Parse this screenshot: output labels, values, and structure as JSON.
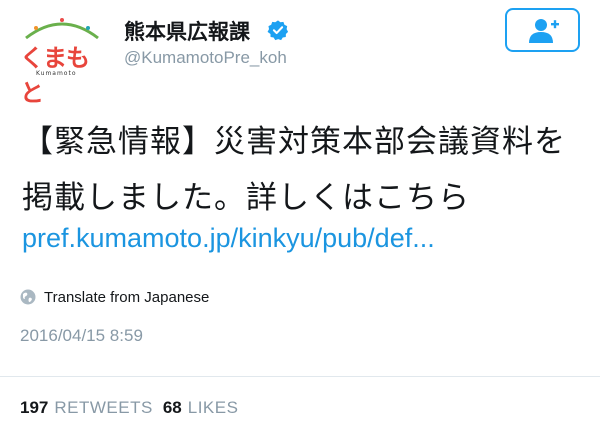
{
  "account": {
    "name": "熊本県広報課",
    "handle": "@KumamotoPre_koh",
    "avatar_text": "くまもと",
    "avatar_sub": "Kumamoto"
  },
  "tweet": {
    "text": "【緊急情報】災害対策本部会議資料を掲載しました。詳しくはこちら",
    "link": "pref.kumamoto.jp/kinkyu/pub/def...",
    "translate_label": "Translate from Japanese",
    "timestamp": "2016/04/15 8:59"
  },
  "stats": {
    "retweets_count": "197",
    "retweets_label": "RETWEETS",
    "likes_count": "68",
    "likes_label": "LIKES"
  },
  "colors": {
    "accent": "#1da1f2",
    "link": "#1b95e0",
    "muted": "#8899a6",
    "text": "#14171a"
  },
  "icons": {
    "verified": "verified-badge-icon",
    "follow": "add-user-icon",
    "globe": "globe-icon"
  }
}
